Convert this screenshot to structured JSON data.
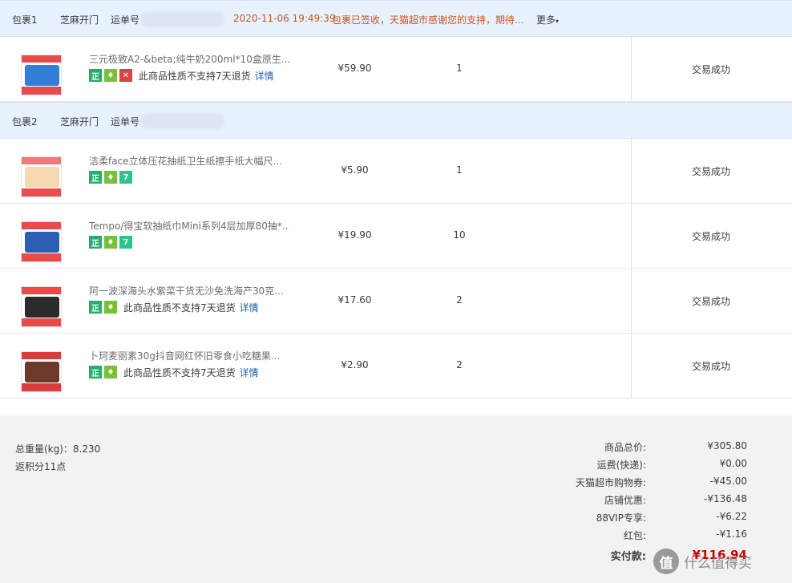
{
  "packages": [
    {
      "label": "包裹1",
      "carrier": "芝麻开门",
      "tracking_label": "运单号",
      "datetime": "2020-11-06 19:49:39",
      "status_msg": "包裹已签收，天猫超市感谢您的支持，期待...",
      "more": "更多"
    },
    {
      "label": "包裹2",
      "carrier": "芝麻开门",
      "tracking_label": "运单号"
    }
  ],
  "items": [
    {
      "title": "三元极致A2-&beta;纯牛奶200ml*10盒原生...",
      "price": "¥59.90",
      "qty": "1",
      "status": "交易成功",
      "note": "此商品性质不支持7天退货",
      "detail": "详情",
      "badges": [
        "正",
        "gift-icon",
        "no-return-icon"
      ],
      "colors": {
        "top": "#e94b4b",
        "mid": "#2f7fd6",
        "bot": "#e94b4b"
      }
    },
    {
      "title": "洁柔face立体压花抽纸卫生纸擦手纸大幅尺...",
      "price": "¥5.90",
      "qty": "1",
      "status": "交易成功",
      "badges": [
        "正",
        "gift-icon",
        "7"
      ],
      "colors": {
        "top": "#f07a7a",
        "mid": "#f6d9b0",
        "bot": "#e8504f"
      }
    },
    {
      "title": "Tempo/得宝软抽纸巾Mini系列4层加厚80抽*...",
      "price": "¥19.90",
      "qty": "10",
      "status": "交易成功",
      "badges": [
        "正",
        "gift-icon",
        "7"
      ],
      "colors": {
        "top": "#e94b4b",
        "mid": "#2a5fb3",
        "bot": "#e94b4b"
      }
    },
    {
      "title": "阿一波深海头水紫菜干货无沙免洗海产30克...",
      "price": "¥17.60",
      "qty": "2",
      "status": "交易成功",
      "note": "此商品性质不支持7天退货",
      "detail": "详情",
      "badges": [
        "正",
        "gift-icon"
      ],
      "colors": {
        "top": "#e94b4b",
        "mid": "#2b2b2b",
        "bot": "#e94b4b"
      }
    },
    {
      "title": "卜珂麦丽素30g抖音网红怀旧零食小吃糖果...",
      "price": "¥2.90",
      "qty": "2",
      "status": "交易成功",
      "note": "此商品性质不支持7天退货",
      "detail": "详情",
      "badges": [
        "正",
        "gift-icon"
      ],
      "colors": {
        "top": "#d93c3c",
        "mid": "#6b3a2a",
        "bot": "#d93c3c"
      }
    }
  ],
  "summary": {
    "weight": "总重量(kg)：8.230",
    "points": "返积分11点",
    "lines": [
      {
        "label": "商品总价:",
        "value": "¥305.80"
      },
      {
        "label": "运费(快递):",
        "value": "¥0.00"
      },
      {
        "label": "天猫超市购物券:",
        "value": "-¥45.00"
      },
      {
        "label": "店铺优惠:",
        "value": "-¥136.48"
      },
      {
        "label": "88VIP专享:",
        "value": "-¥6.22"
      },
      {
        "label": "红包:",
        "value": "-¥1.16"
      }
    ],
    "final_label": "实付款:",
    "final_value": "¥116.94"
  },
  "watermark": {
    "logo": "值",
    "text": "什么值得买"
  }
}
